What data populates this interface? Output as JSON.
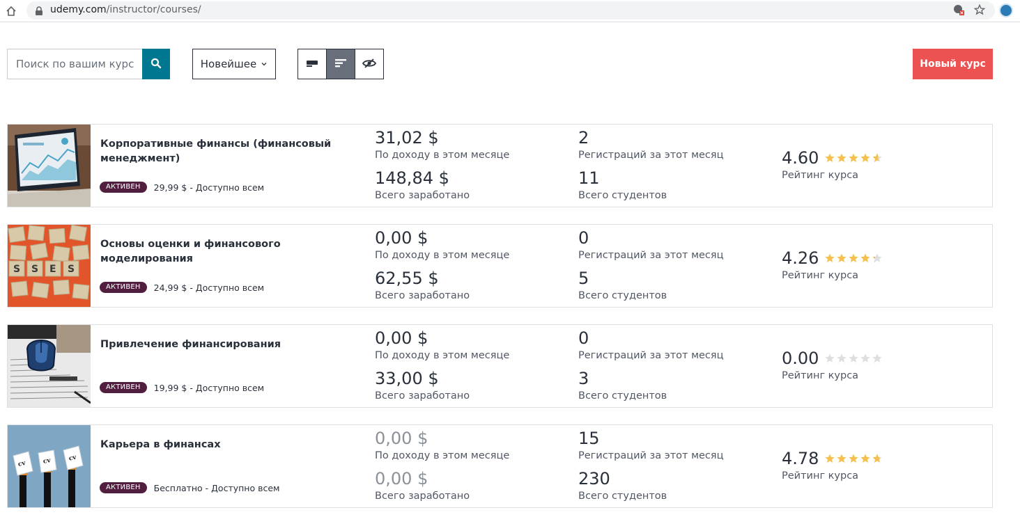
{
  "browser": {
    "url_host": "udemy.com",
    "url_path": "/instructor/courses/"
  },
  "toolbar": {
    "search_placeholder": "Поиск по вашим курсам",
    "sort_label": "Новейшее",
    "new_course_label": "Новый курс"
  },
  "colors": {
    "search_button": "#007791",
    "new_course_button": "#ec5252",
    "badge": "#521e3f",
    "star_filled": "#f4c150",
    "star_empty": "#dedfe0"
  },
  "courses": [
    {
      "title": "Корпоративные финансы (финансовый менеджмент)",
      "status": "АКТИВЕН",
      "price": "29,99 $ - Доступно всем",
      "month_revenue": "31,02 $",
      "month_revenue_label": "По доходу в этом месяце",
      "total_revenue": "148,84 $",
      "total_revenue_label": "Всего заработано",
      "month_enrollments": "2",
      "month_enrollments_label": "Регистраций за этот месяц",
      "total_students": "11",
      "total_students_label": "Всего студентов",
      "rating": "4.60",
      "rating_label": "Рейтинг курса"
    },
    {
      "title": "Основы оценки и финансового моделирования",
      "status": "АКТИВЕН",
      "price": "24,99 $ - Доступно всем",
      "month_revenue": "0,00 $",
      "month_revenue_label": "По доходу в этом месяце",
      "total_revenue": "62,55 $",
      "total_revenue_label": "Всего заработано",
      "month_enrollments": "0",
      "month_enrollments_label": "Регистраций за этот месяц",
      "total_students": "5",
      "total_students_label": "Всего студентов",
      "rating": "4.26",
      "rating_label": "Рейтинг курса"
    },
    {
      "title": "Привлечение финансирования",
      "status": "АКТИВЕН",
      "price": "19,99 $ - Доступно всем",
      "month_revenue": "0,00 $",
      "month_revenue_label": "По доходу в этом месяце",
      "total_revenue": "33,00 $",
      "total_revenue_label": "Всего заработано",
      "month_enrollments": "0",
      "month_enrollments_label": "Регистраций за этот месяц",
      "total_students": "3",
      "total_students_label": "Всего студентов",
      "rating": "0.00",
      "rating_label": "Рейтинг курса"
    },
    {
      "title": "Карьера в финансах",
      "status": "АКТИВЕН",
      "price": "Бесплатно - Доступно всем",
      "month_revenue": "0,00 $",
      "month_revenue_label": "По доходу в этом месяце",
      "total_revenue": "0,00 $",
      "total_revenue_label": "Всего заработано",
      "month_enrollments": "15",
      "month_enrollments_label": "Регистраций за этот месяц",
      "total_students": "230",
      "total_students_label": "Всего студентов",
      "rating": "4.78",
      "rating_label": "Рейтинг курса"
    }
  ]
}
